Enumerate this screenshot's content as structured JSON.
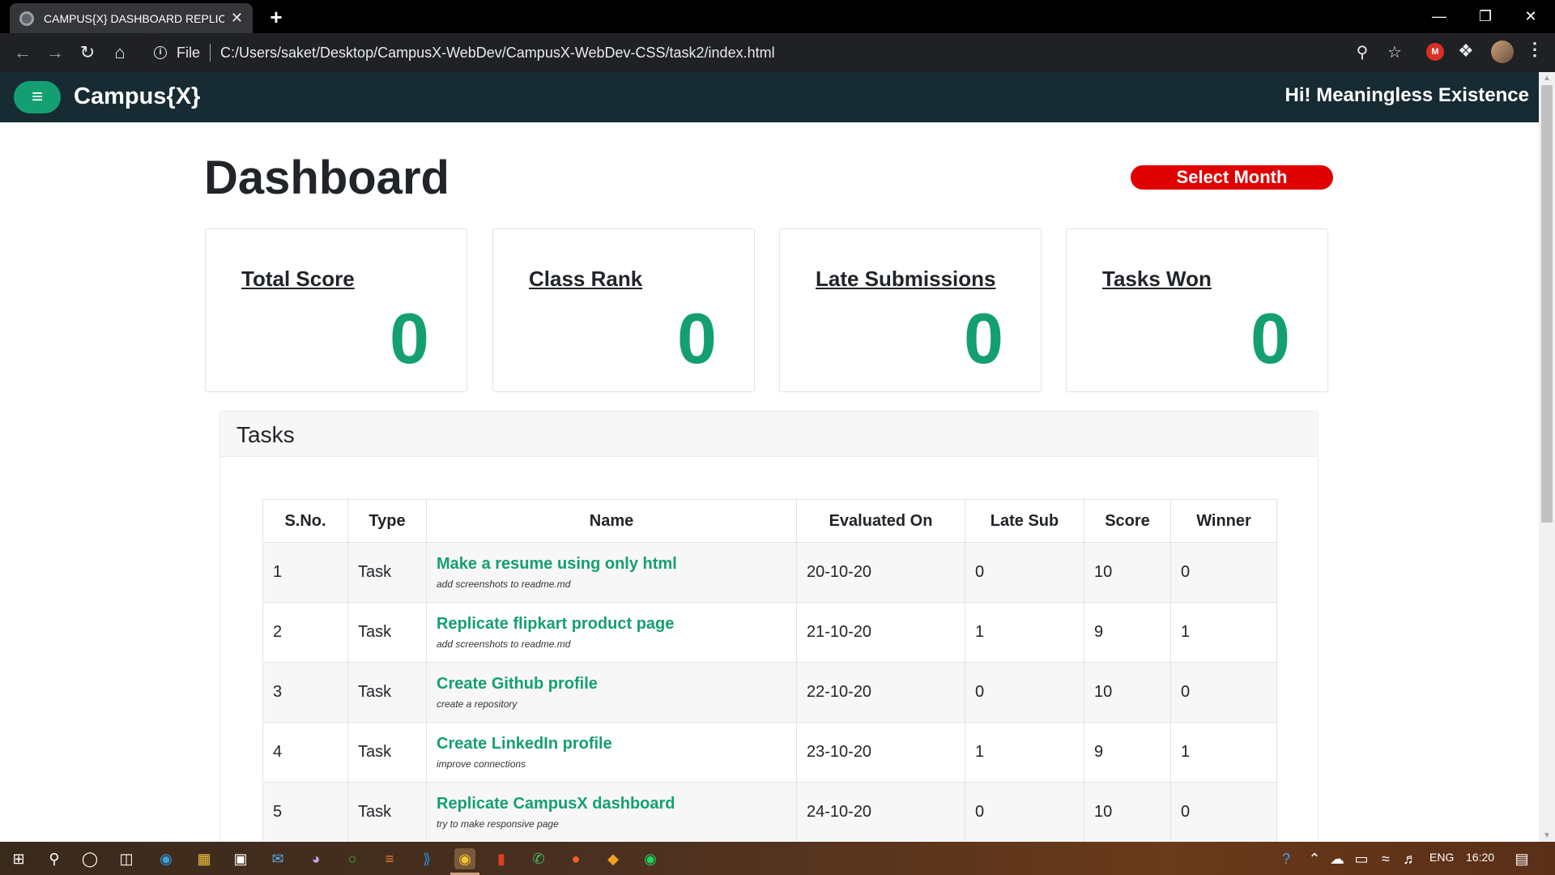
{
  "browser": {
    "tab_title": "CAMPUS{X} DASHBOARD REPLIC",
    "tab_close": "✕",
    "new_tab": "+",
    "omnibox_scheme": "File",
    "url": "C:/Users/saket/Desktop/CampusX-WebDev/CampusX-WebDev-CSS/task2/index.html",
    "ext_m": "M"
  },
  "navbar": {
    "brand": "Campus{X}",
    "greeting": "Hi! Meaningless Existence",
    "menu_icon": "≡"
  },
  "dashboard": {
    "title": "Dashboard",
    "select_month": "Select Month",
    "stats": [
      {
        "label": "Total Score",
        "value": "0"
      },
      {
        "label": "Class Rank",
        "value": "0"
      },
      {
        "label": "Late Submissions",
        "value": "0"
      },
      {
        "label": "Tasks Won",
        "value": "0"
      }
    ]
  },
  "tasks": {
    "title": "Tasks",
    "columns": [
      "S.No.",
      "Type",
      "Name",
      "Evaluated On",
      "Late Sub",
      "Score",
      "Winner"
    ],
    "rows": [
      {
        "sno": "1",
        "type": "Task",
        "name": "Make a resume using only html",
        "note": "add screenshots to readme.md",
        "evaluated": "20-10-20",
        "late": "0",
        "score": "10",
        "winner": "0"
      },
      {
        "sno": "2",
        "type": "Task",
        "name": "Replicate flipkart product page",
        "note": "add screenshots to readme.md",
        "evaluated": "21-10-20",
        "late": "1",
        "score": "9",
        "winner": "1"
      },
      {
        "sno": "3",
        "type": "Task",
        "name": "Create Github profile",
        "note": "create a repository",
        "evaluated": "22-10-20",
        "late": "0",
        "score": "10",
        "winner": "0"
      },
      {
        "sno": "4",
        "type": "Task",
        "name": "Create LinkedIn profile",
        "note": "improve connections",
        "evaluated": "23-10-20",
        "late": "1",
        "score": "9",
        "winner": "1"
      },
      {
        "sno": "5",
        "type": "Task",
        "name": "Replicate CampusX dashboard",
        "note": "try to make responsive page",
        "evaluated": "24-10-20",
        "late": "0",
        "score": "10",
        "winner": "0"
      }
    ]
  },
  "taskbar": {
    "language": "ENG",
    "time": "16:20"
  },
  "colors": {
    "navbar_bg": "#172b33",
    "accent_green": "#149f72",
    "select_month_red": "#e00000",
    "title_text": "#212529"
  }
}
